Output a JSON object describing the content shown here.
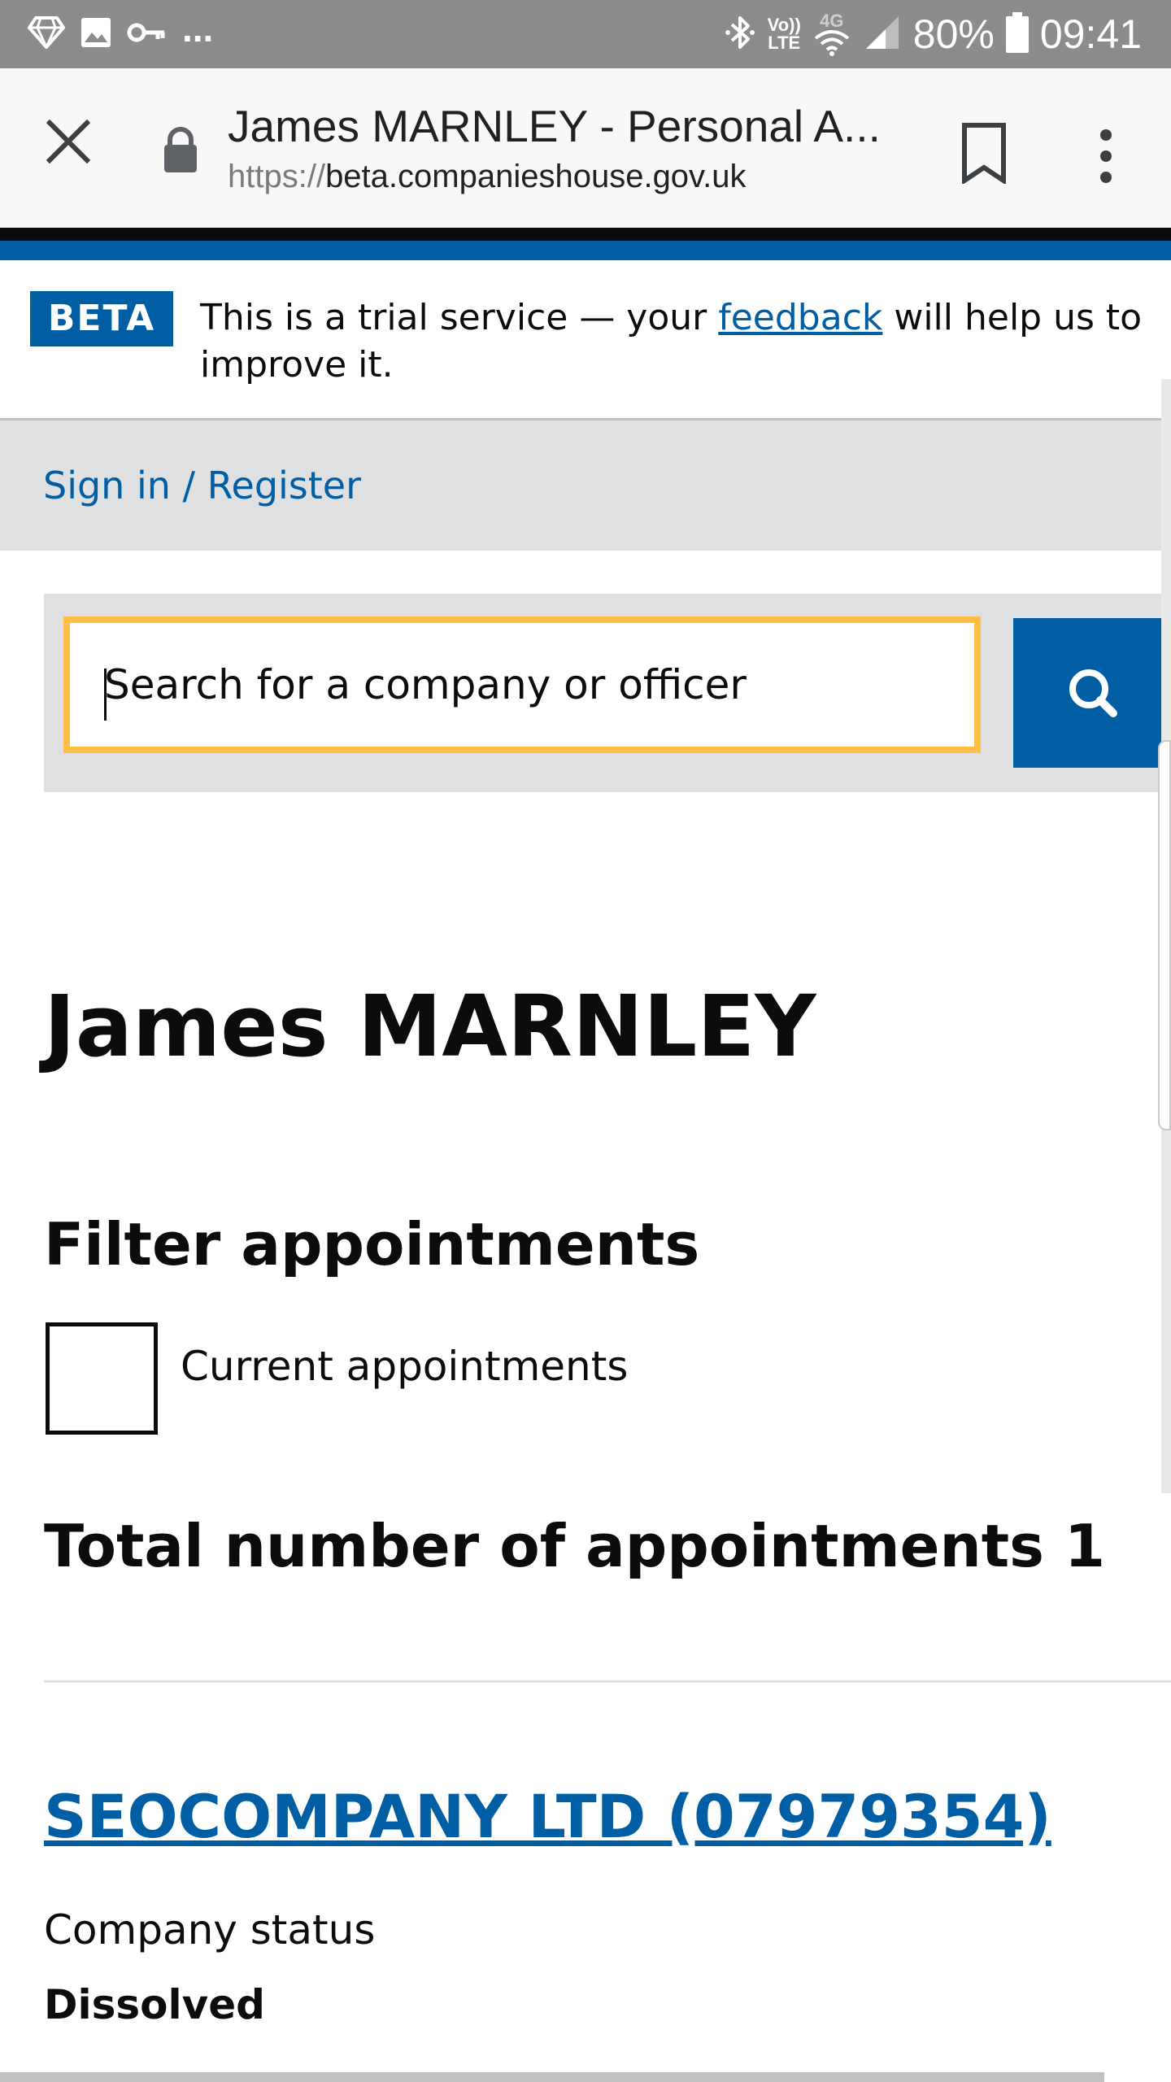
{
  "status_bar": {
    "overflow_indicator": "...",
    "volte_top": "Vo))",
    "volte_bottom": "LTE",
    "network_type": "4G",
    "battery_percent": "80%",
    "time": "09:41",
    "icons": [
      "diamond-icon",
      "gallery-icon",
      "key-icon",
      "bluetooth-icon",
      "wifi-icon",
      "signal-icon",
      "battery-icon"
    ]
  },
  "toolbar": {
    "page_title": "James MARNLEY - Personal A...",
    "url_scheme": "https://",
    "url_host": "beta.companieshouse.gov.uk",
    "icons": [
      "close-icon",
      "lock-icon",
      "bookmark-icon",
      "more-vert-icon"
    ]
  },
  "beta_banner": {
    "tag": "BETA",
    "message_before": "This is a trial service — your ",
    "feedback_link": "feedback",
    "message_after": " will help us to improve it."
  },
  "nav": {
    "sign_in": "Sign in / Register"
  },
  "search": {
    "placeholder": "Search for a company or officer",
    "value": ""
  },
  "main": {
    "officer_name": "James MARNLEY",
    "filter_heading": "Filter appointments",
    "filter_checkbox_label": "Current appointments",
    "filter_checked": false,
    "total_heading": "Total number of appointments 1",
    "appointments": [
      {
        "company": "SEOCOMPANY LTD (07979354)",
        "status_label": "Company status",
        "status_value": "Dissolved"
      }
    ]
  },
  "colors": {
    "brand_blue": "#005ea5",
    "focus_yellow": "#ffbf47",
    "panel_grey": "#dee0e2",
    "text_black": "#0b0c0c",
    "status_bar_grey": "#8c8c8c"
  }
}
